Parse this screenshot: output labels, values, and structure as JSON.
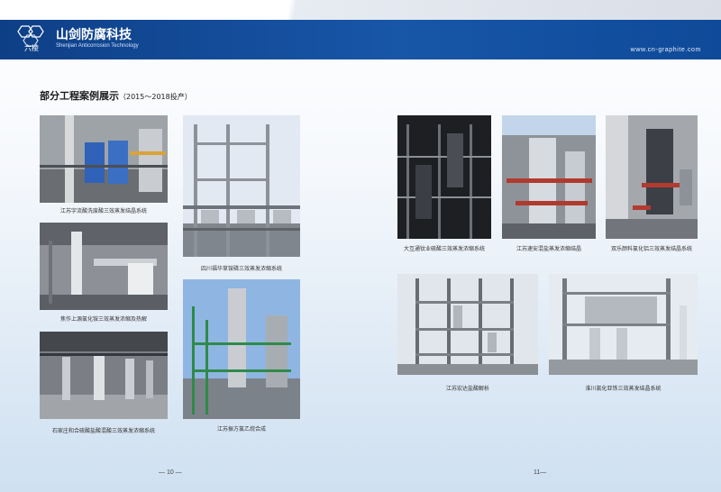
{
  "header": {
    "logo_mark": "六棱",
    "brand_cn": "山剑防腐科技",
    "brand_en": "Shenjian Anticorrosion Technology",
    "url": "www.cn-graphite.com"
  },
  "title": {
    "main": "部分工程案例展示",
    "sub": "（2015～2018投产）"
  },
  "captions": {
    "c1": "江苏宇流酸洗废酸三效蒸发结晶系统",
    "c2": "焦作上源氯化铵三效蒸发浓缩及热解",
    "c3": "石家庄和合硫酸盐酸混酸三效蒸发浓缩系统",
    "c4": "四川福华草铵磷三效蒸发浓缩系统",
    "c5": "江苏振方氯乙烷合成",
    "c6": "大互通钛业硫酸三效蒸发浓缩系统",
    "c7": "江苏速安混盐蒸发浓缩结晶",
    "c8": "双乐颜料氯化铝三效蒸发结晶系统",
    "c9": "江苏宏达盐酸解析",
    "c10": "淮川氯化亚铁三效蒸发结晶系统"
  },
  "pages": {
    "left": "— 10 —",
    "right": "11—"
  },
  "colors": {
    "header_blue": "#1856a8",
    "background_bottom": "#cfe0f1"
  },
  "icons": {
    "logo": "hexagon-logo-icon"
  }
}
